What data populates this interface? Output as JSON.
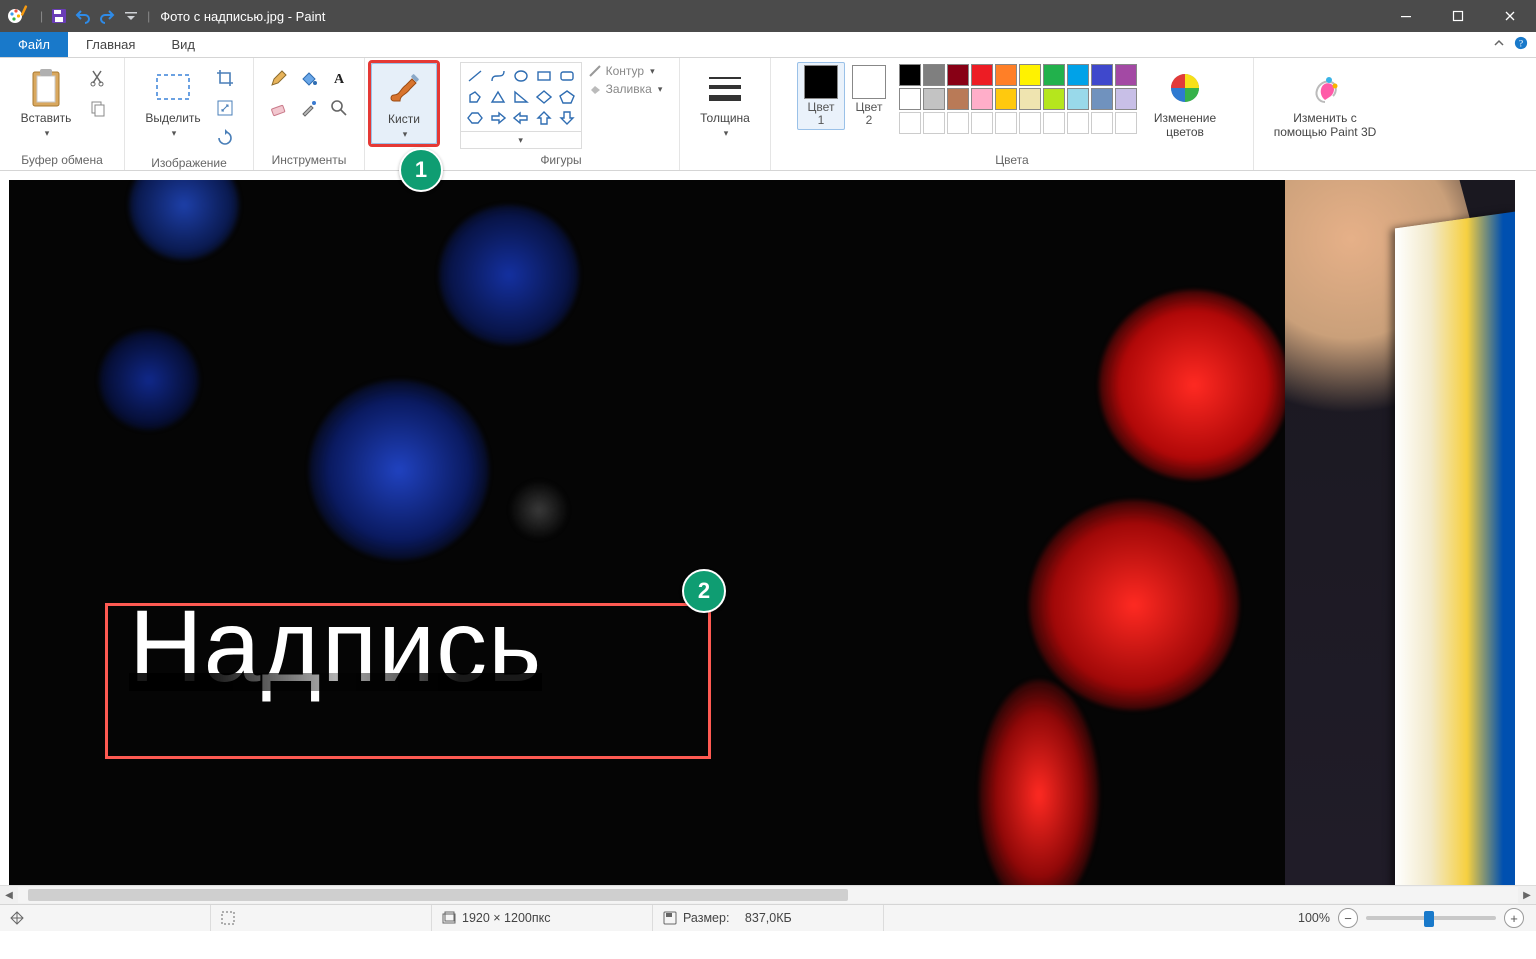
{
  "title": "Фото с надписью.jpg - Paint",
  "tabs": {
    "file": "Файл",
    "home": "Главная",
    "view": "Вид"
  },
  "groups": {
    "clipboard": "Буфер обмена",
    "image": "Изображение",
    "tools": "Инструменты",
    "shapes": "Фигуры",
    "colors": "Цвета"
  },
  "buttons": {
    "paste": "Вставить",
    "select": "Выделить",
    "brushes": "Кисти",
    "outline": "Контур",
    "fill": "Заливка",
    "thickness": "Толщина",
    "color1": "Цвет\n1",
    "color2": "Цвет\n2",
    "editColors": "Изменение\nцветов",
    "paint3d": "Изменить с\nпомощью Paint 3D"
  },
  "palette": {
    "row1": [
      "#000000",
      "#7f7f7f",
      "#880015",
      "#ed1c24",
      "#ff7f27",
      "#fff200",
      "#22b14c",
      "#00a2e8",
      "#3f48cc",
      "#a349a4"
    ],
    "row2": [
      "#ffffff",
      "#c3c3c3",
      "#b97a57",
      "#ffaec9",
      "#ffc90e",
      "#efe4b0",
      "#b5e61d",
      "#99d9ea",
      "#7092be",
      "#c8bfe7"
    ]
  },
  "annotation": {
    "badge1": "1",
    "badge2": "2",
    "text": "Надпись"
  },
  "status": {
    "dimensions": "1920 × 1200пкс",
    "sizeLabel": "Размер:",
    "sizeValue": "837,0КБ",
    "zoom": "100%"
  }
}
